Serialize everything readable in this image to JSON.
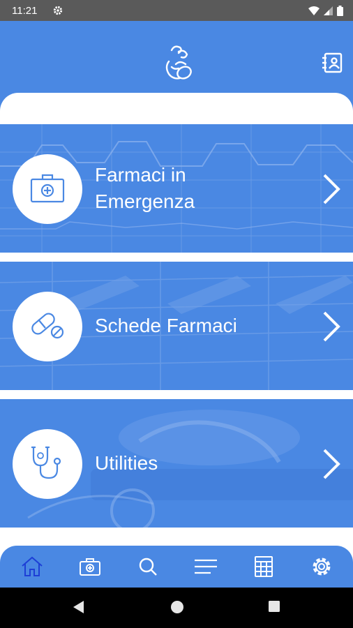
{
  "status_bar": {
    "time": "11:21",
    "icons": [
      "settings-icon",
      "wifi-icon",
      "signal-icon",
      "battery-icon"
    ]
  },
  "header": {
    "logo_icon": "baby-logo-icon",
    "contacts_icon": "contact-book-icon"
  },
  "cards": [
    {
      "label_line1": "Farmaci in",
      "label_line2": "Emergenza",
      "icon": "medical-kit-icon"
    },
    {
      "label": "Schede Farmaci",
      "icon": "pill-icon"
    },
    {
      "label": "Utilities",
      "icon": "stethoscope-icon"
    }
  ],
  "bottom_nav": {
    "items": [
      "home-icon",
      "medical-kit-icon",
      "search-icon",
      "menu-icon",
      "calculator-icon",
      "settings-icon"
    ],
    "active": "home-icon"
  },
  "colors": {
    "primary": "#4a88e3",
    "active_icon": "#1d3fd6",
    "status_bar": "#5a5a5a"
  }
}
